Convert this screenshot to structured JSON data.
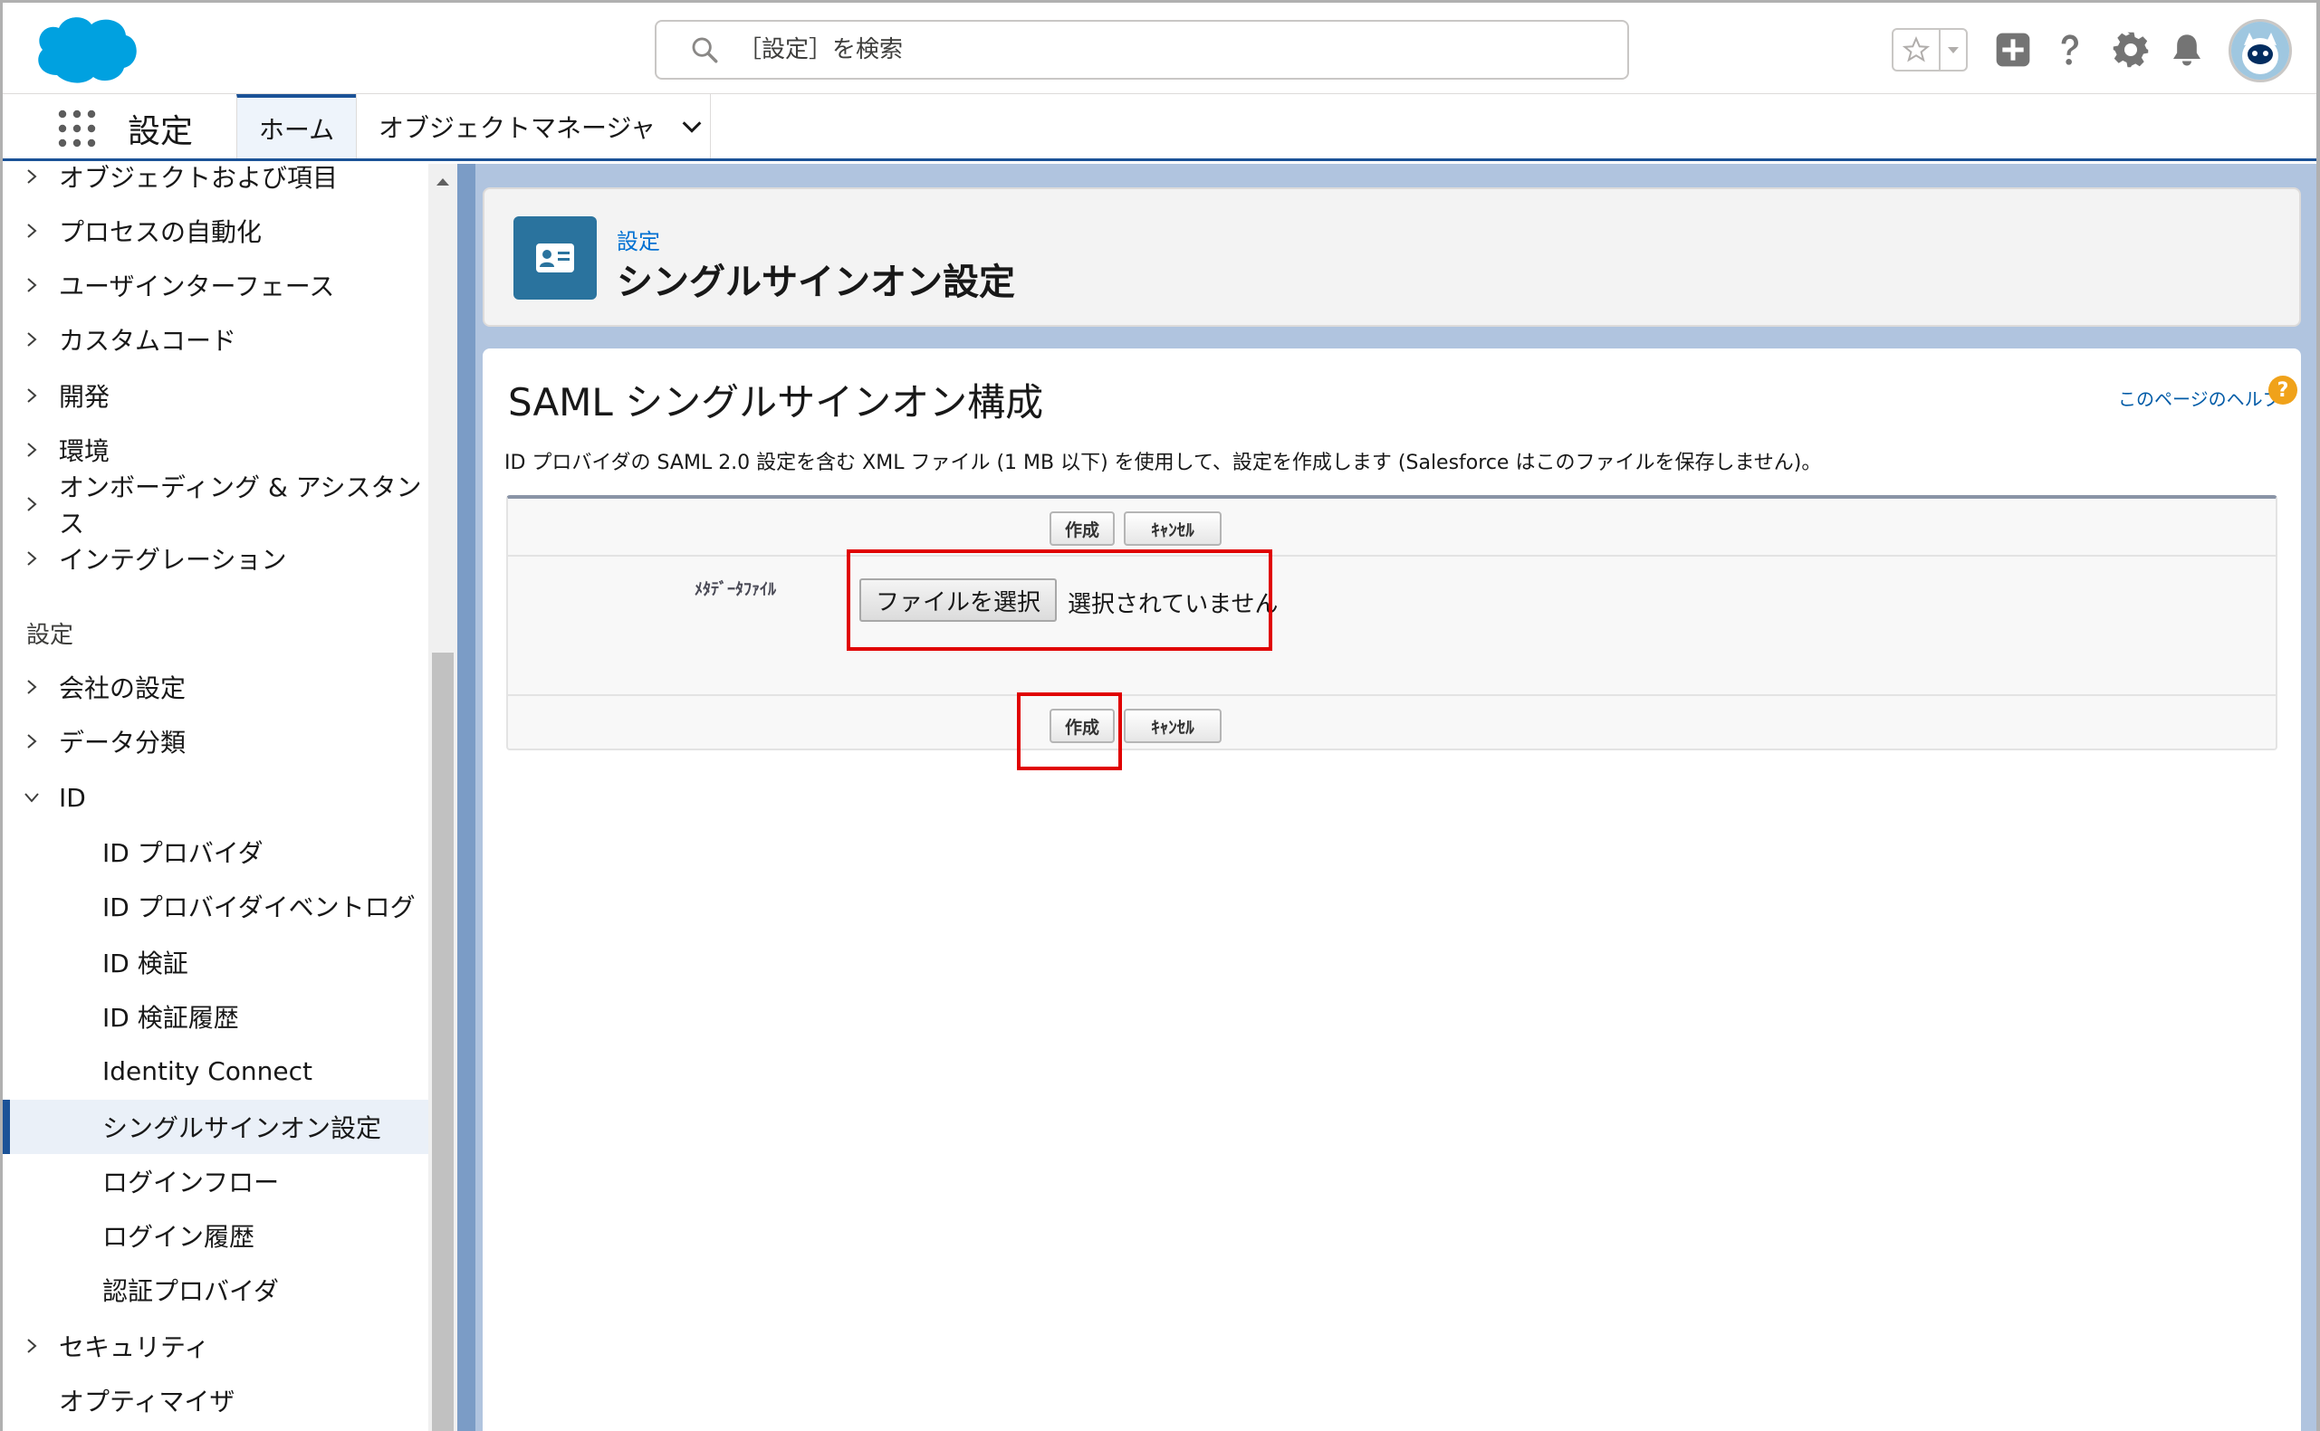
{
  "header": {
    "search_placeholder": "［設定］を検索"
  },
  "context": {
    "app_name": "設定",
    "tabs": [
      {
        "label": "ホーム"
      },
      {
        "label": "オブジェクトマネージャ"
      }
    ]
  },
  "sidebar": {
    "top_items": [
      {
        "label": "オブジェクトおよび項目"
      },
      {
        "label": "プロセスの自動化"
      },
      {
        "label": "ユーザインターフェース"
      },
      {
        "label": "カスタムコード"
      },
      {
        "label": "開発"
      },
      {
        "label": "環境"
      },
      {
        "label": "オンボーディング & アシスタンス"
      },
      {
        "label": "インテグレーション"
      }
    ],
    "section_title": "設定",
    "section_items": [
      {
        "label": "会社の設定"
      },
      {
        "label": "データ分類"
      },
      {
        "label": "ID"
      }
    ],
    "id_children": [
      {
        "label": "ID プロバイダ"
      },
      {
        "label": "ID プロバイダイベントログ"
      },
      {
        "label": "ID 検証"
      },
      {
        "label": "ID 検証履歴"
      },
      {
        "label": "Identity Connect"
      },
      {
        "label": "シングルサインオン設定"
      },
      {
        "label": "ログインフロー"
      },
      {
        "label": "ログイン履歴"
      },
      {
        "label": "認証プロバイダ"
      }
    ],
    "bottom_items": [
      {
        "label": "セキュリティ"
      },
      {
        "label": "オプティマイザ"
      }
    ]
  },
  "page_header": {
    "breadcrumb": "設定",
    "title": "シングルサインオン設定"
  },
  "content": {
    "heading": "SAML シングルサインオン構成",
    "help_link": "このページのヘルプ",
    "description": "ID プロバイダの SAML 2.0 設定を含む XML ファイル (1 MB 以下) を使用して、設定を作成します (Salesforce はこのファイルを保存しません)。",
    "create_label": "作成",
    "cancel_label": "ｷｬﾝｾﾙ",
    "field_label": "ﾒﾀﾃﾞｰﾀﾌｧｲﾙ",
    "file_button": "ファイルを選択",
    "file_status": "選択されていません"
  },
  "colors": {
    "brand_blue": "#1b5297",
    "link_blue": "#0070d2",
    "highlight_red": "#e00000",
    "header_icon_bg": "#2a739e"
  }
}
